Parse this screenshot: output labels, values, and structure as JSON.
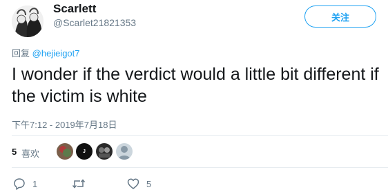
{
  "tweet": {
    "author_name": "Scarlett",
    "author_handle": "@Scarlet21821353",
    "follow_label": "关注",
    "reply_prefix": "回复",
    "reply_mention": "@hejieigot7",
    "text": "I wonder if the verdict would a little bit different if the victim is white",
    "timestamp": "下午7:12 - 2019年7月18日"
  },
  "stats": {
    "likes_count": "5",
    "likes_label": "喜欢",
    "liker_avatars": [
      "liker-avatar-1",
      "liker-avatar-2",
      "liker-avatar-3",
      "liker-avatar-4"
    ],
    "liker_2_initial": "J"
  },
  "actions": {
    "reply_count": "1",
    "retweet_count": "",
    "like_count": "5"
  },
  "colors": {
    "accent": "#1da1f2",
    "secondary_text": "#657786",
    "divider": "#e6ecf0"
  }
}
